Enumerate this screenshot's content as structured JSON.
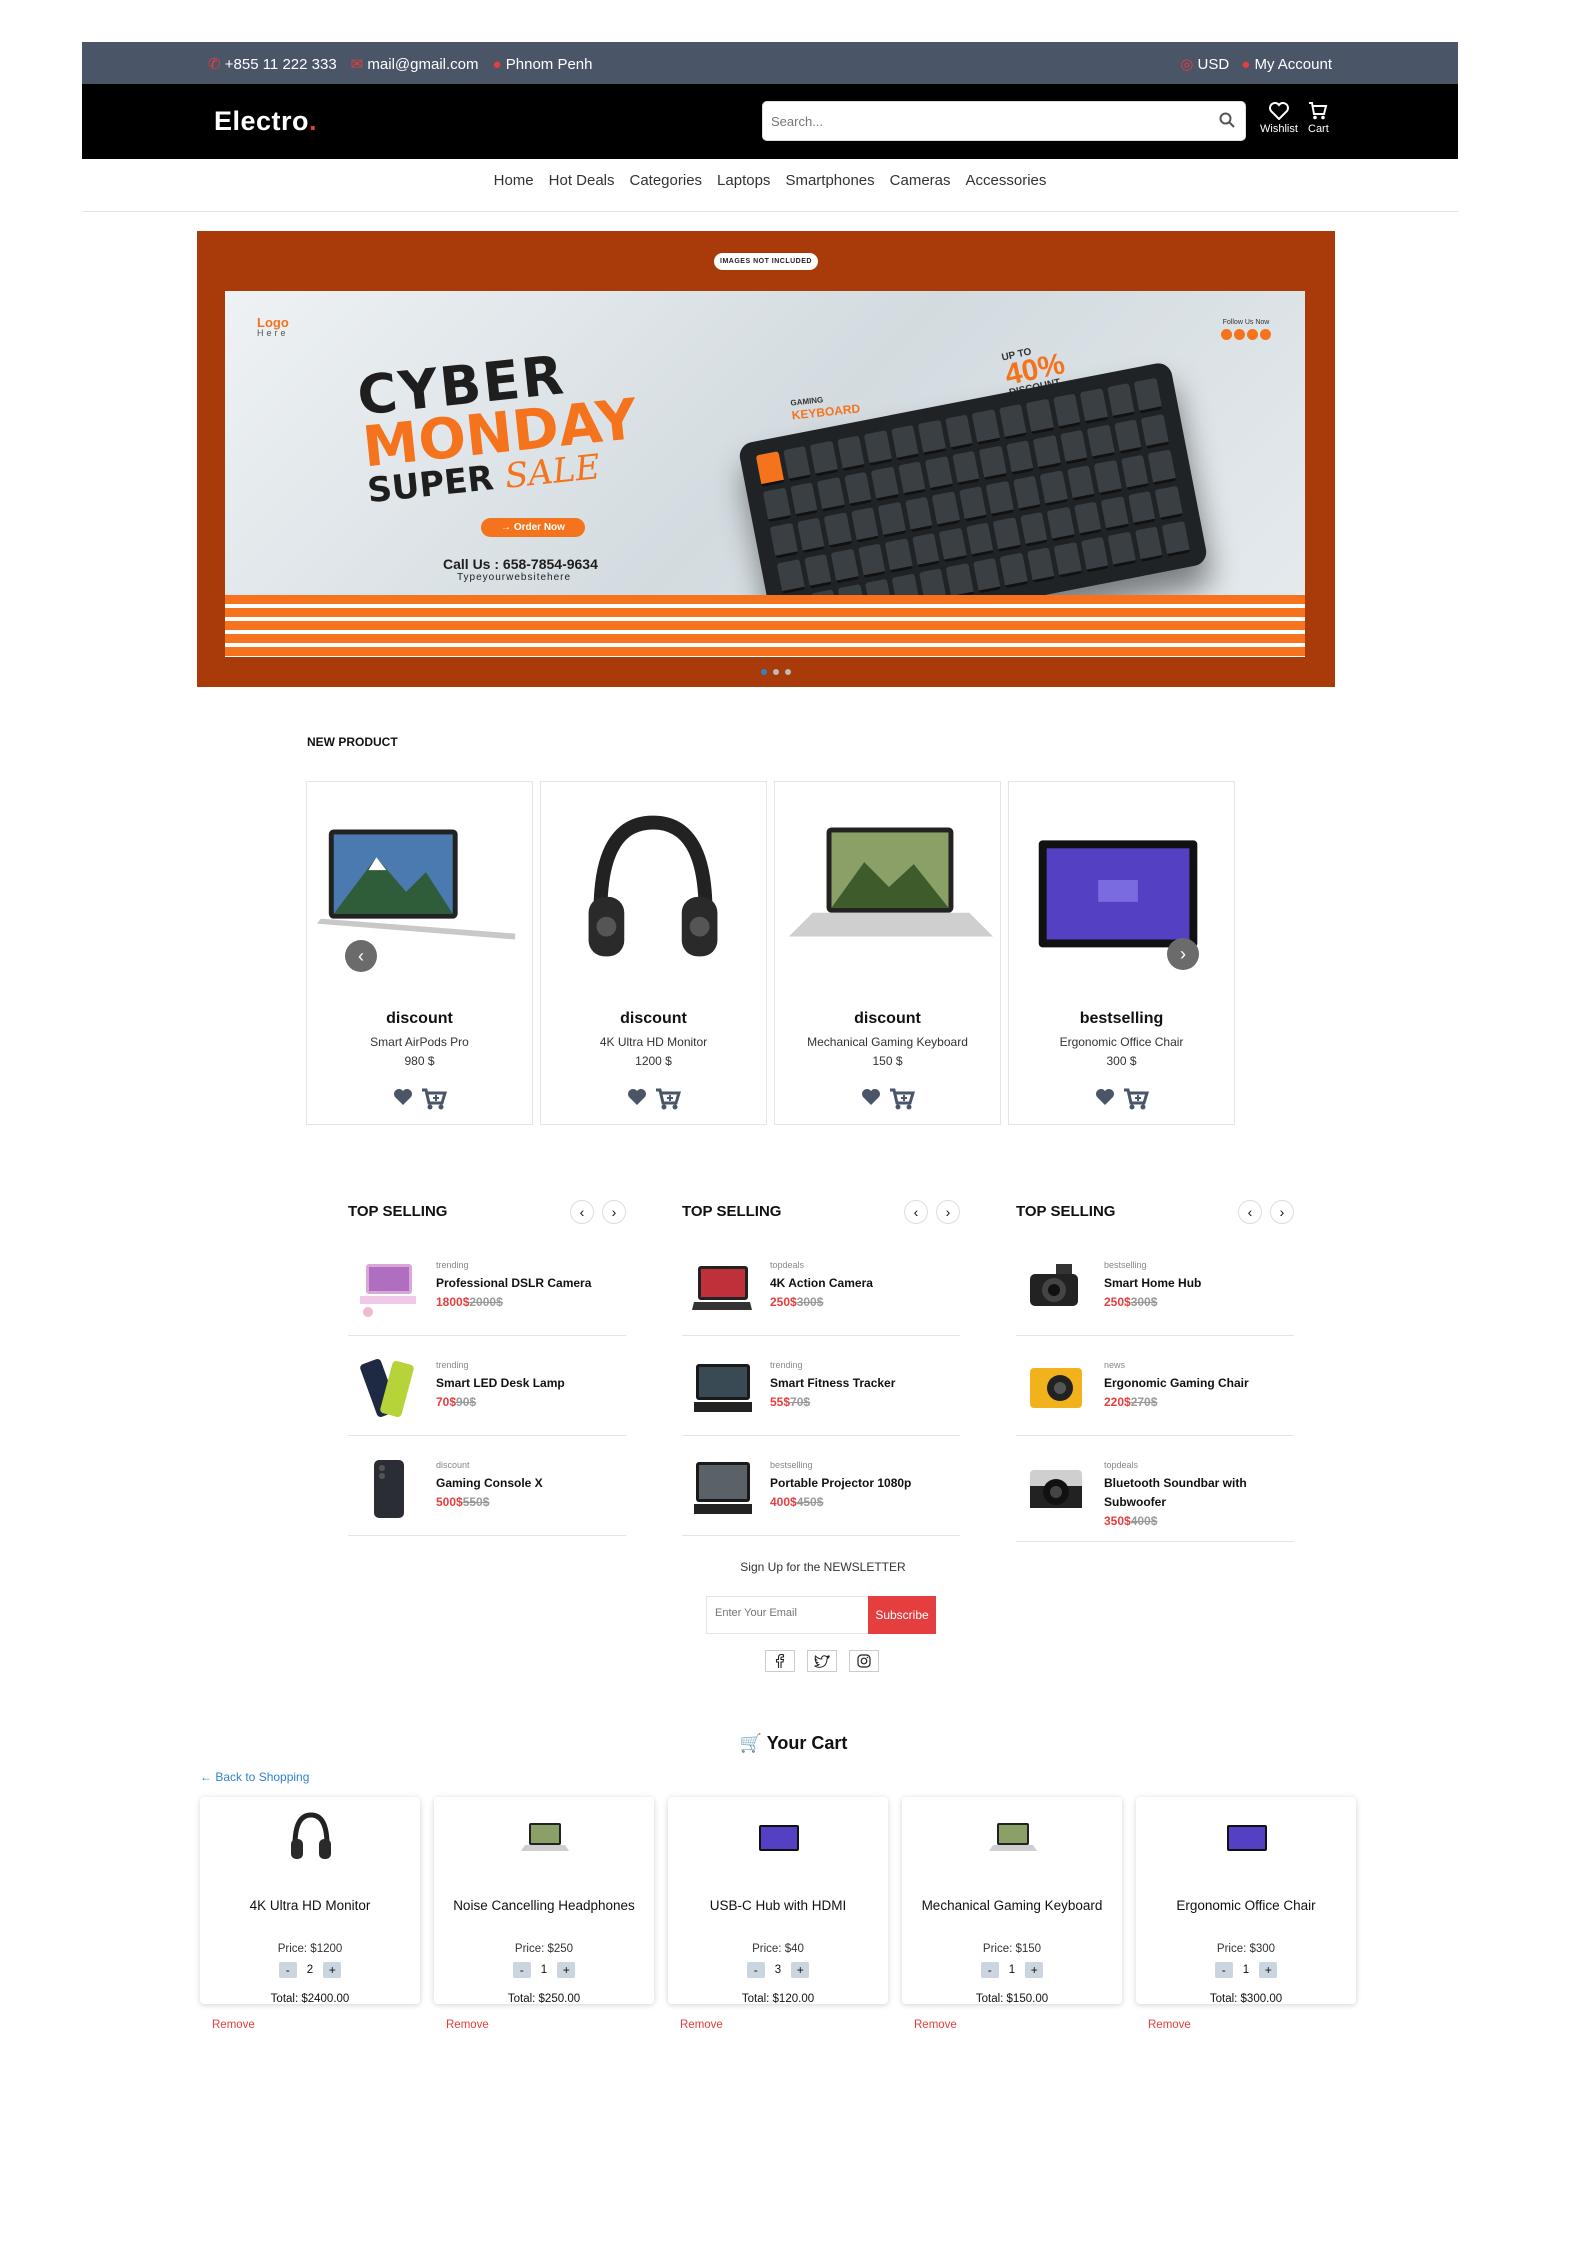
{
  "topbar": {
    "phone": "+855 11 222 333",
    "email": "mail@gmail.com",
    "location": "Phnom Penh",
    "currency": "USD",
    "account": "My Account"
  },
  "header": {
    "logo": "Electro",
    "search_placeholder": "Search...",
    "wishlist": "Wishlist",
    "cart": "Cart"
  },
  "nav": [
    "Home",
    "Hot Deals",
    "Categories",
    "Laptops",
    "Smartphones",
    "Cameras",
    "Accessories"
  ],
  "banner": {
    "badge": "IMAGES NOT INCLUDED",
    "logo_text": "Logo",
    "logo_sub": "Here",
    "follow": "Follow Us Now",
    "line1": "CYBER",
    "line2": "MONDAY",
    "line3": "SUPER",
    "line3b": "SALE",
    "order_btn": "Order Now",
    "call": "Call Us : 658-7854-9634",
    "website": "Typeyourwebsitehere",
    "kbd_small": "GAMING",
    "kbd_big": "KEYBOARD",
    "upto": "UP TO",
    "pct": "40%",
    "discount": "DISCOUNT"
  },
  "new_product": {
    "title": "NEW PRODUCT",
    "items": [
      {
        "category": "discount",
        "name": "Smart AirPods Pro",
        "price": "980 $",
        "img": "laptop-mountain"
      },
      {
        "category": "discount",
        "name": "4K Ultra HD Monitor",
        "price": "1200 $",
        "img": "headphones"
      },
      {
        "category": "discount",
        "name": "Mechanical Gaming Keyboard",
        "price": "150 $",
        "img": "laptop-green"
      },
      {
        "category": "bestselling",
        "name": "Ergonomic Office Chair",
        "price": "300 $",
        "img": "tablet"
      }
    ]
  },
  "top_selling": [
    {
      "title": "TOP SELLING",
      "items": [
        {
          "tag": "trending",
          "name": "Professional DSLR Camera",
          "price": "1800$",
          "old": "2000$",
          "img": "pink-laptop"
        },
        {
          "tag": "trending",
          "name": "Smart LED Desk Lamp",
          "price": "70$",
          "old": "90$",
          "img": "phones"
        },
        {
          "tag": "discount",
          "name": "Gaming Console X",
          "price": "500$",
          "old": "550$",
          "img": "smartphone"
        }
      ]
    },
    {
      "title": "TOP SELLING",
      "items": [
        {
          "tag": "topdeals",
          "name": "4K Action Camera",
          "price": "250$",
          "old": "300$",
          "img": "laptop-red"
        },
        {
          "tag": "trending",
          "name": "Smart Fitness Tracker",
          "price": "55$",
          "old": "70$",
          "img": "laptop-dark"
        },
        {
          "tag": "bestselling",
          "name": "Portable Projector 1080p",
          "price": "400$",
          "old": "450$",
          "img": "laptop-dark2"
        }
      ]
    },
    {
      "title": "TOP SELLING",
      "items": [
        {
          "tag": "bestselling",
          "name": "Smart Home Hub",
          "price": "250$",
          "old": "300$",
          "img": "camera"
        },
        {
          "tag": "news",
          "name": "Ergonomic Gaming Chair",
          "price": "220$",
          "old": "270$",
          "img": "yellow-camera"
        },
        {
          "tag": "topdeals",
          "name": "Bluetooth Soundbar with Subwoofer",
          "price": "350$",
          "old": "400$",
          "img": "camera-black"
        }
      ]
    }
  ],
  "newsletter": {
    "title": "Sign Up for the NEWSLETTER",
    "placeholder": "Enter Your Email",
    "button": "Subscribe"
  },
  "cart": {
    "title": "Your Cart",
    "back": "← Back to Shopping",
    "items": [
      {
        "name": "4K Ultra HD Monitor",
        "price": "Price: $1200",
        "qty": "2",
        "total": "Total: $2400.00",
        "img": "headphones"
      },
      {
        "name": "Noise Cancelling Headphones",
        "price": "Price: $250",
        "qty": "1",
        "total": "Total: $250.00",
        "img": "laptop-green"
      },
      {
        "name": "USB-C Hub with HDMI",
        "price": "Price: $40",
        "qty": "3",
        "total": "Total: $120.00",
        "img": "tablet"
      },
      {
        "name": "Mechanical Gaming Keyboard",
        "price": "Price: $150",
        "qty": "1",
        "total": "Total: $150.00",
        "img": "laptop-green"
      },
      {
        "name": "Ergonomic Office Chair",
        "price": "Price: $300",
        "qty": "1",
        "total": "Total: $300.00",
        "img": "tablet"
      }
    ],
    "minus": "-",
    "plus": "+",
    "remove": "Remove"
  }
}
